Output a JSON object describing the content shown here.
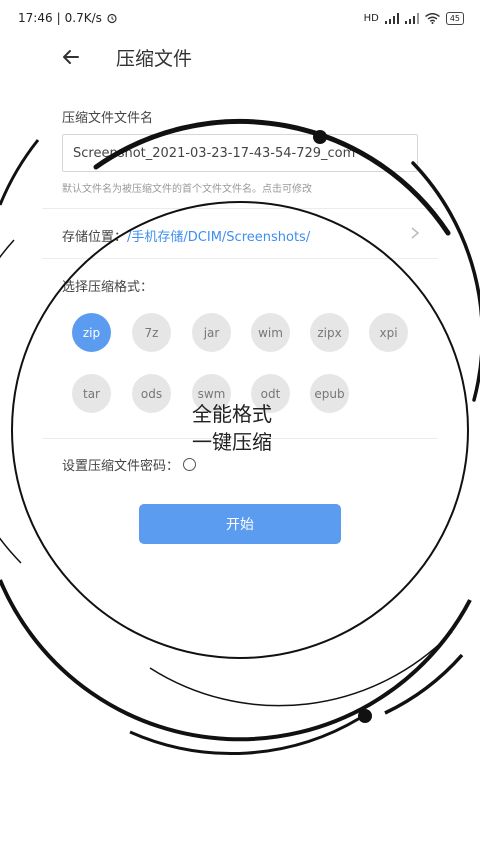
{
  "status": {
    "time": "17:46",
    "speed": "0.7K/s",
    "signal_a": "HD",
    "battery": "45"
  },
  "appbar": {
    "title": "压缩文件"
  },
  "filename": {
    "label": "压缩文件文件名",
    "value": "Screenshot_2021-03-23-17-43-54-729_com",
    "hint": "默认文件名为被压缩文件的首个文件文件名。点击可修改"
  },
  "storage": {
    "label": "存储位置：",
    "path": "/手机存储/DCIM/Screenshots/"
  },
  "format": {
    "label": "选择压缩格式：",
    "options": [
      "zip",
      "7z",
      "jar",
      "wim",
      "zipx",
      "xpi",
      "tar",
      "ods",
      "swm",
      "odt",
      "epub"
    ],
    "selected": "zip"
  },
  "promo": {
    "line1": "全能格式",
    "line2": "一键压缩"
  },
  "password": {
    "label": "设置压缩文件密码："
  },
  "start_button": {
    "label": "开始"
  },
  "colors": {
    "accent": "#5b9cf0",
    "link": "#3f8ef0"
  }
}
